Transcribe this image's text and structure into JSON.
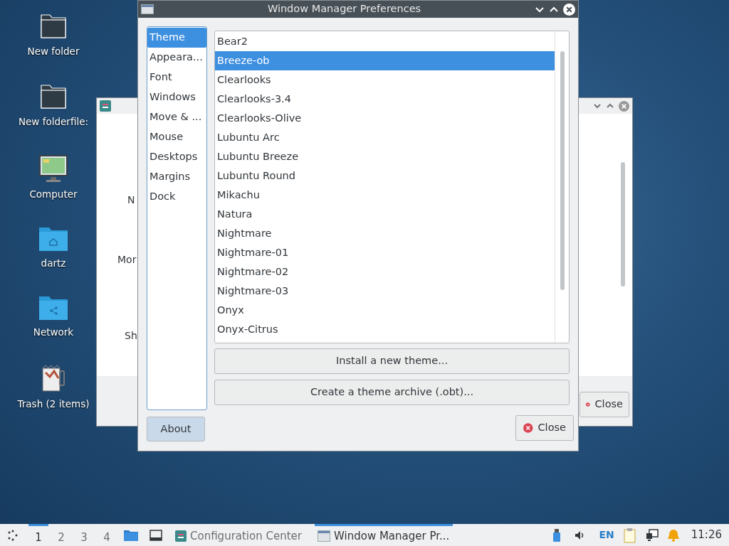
{
  "desktop_icons": [
    {
      "label": "New folder",
      "kind": "folder"
    },
    {
      "label": "New folderfile:",
      "kind": "folder"
    },
    {
      "label": "Computer",
      "kind": "computer"
    },
    {
      "label": "dartz",
      "kind": "home"
    },
    {
      "label": "Network",
      "kind": "network"
    },
    {
      "label": "Trash (2 items)",
      "kind": "trash"
    }
  ],
  "background_window": {
    "labels": [
      "N",
      "Mor",
      "Sh"
    ],
    "close_button": "Close"
  },
  "window": {
    "title": "Window Manager Preferences",
    "sidebar": [
      {
        "label": "Theme",
        "selected": true
      },
      {
        "label": "Appeara...",
        "selected": false
      },
      {
        "label": "Font",
        "selected": false
      },
      {
        "label": "Windows",
        "selected": false
      },
      {
        "label": "Move & ...",
        "selected": false
      },
      {
        "label": "Mouse",
        "selected": false
      },
      {
        "label": "Desktops",
        "selected": false
      },
      {
        "label": "Margins",
        "selected": false
      },
      {
        "label": "Dock",
        "selected": false
      }
    ],
    "themes": [
      {
        "name": "Bear2",
        "selected": false
      },
      {
        "name": "Breeze-ob",
        "selected": true
      },
      {
        "name": "Clearlooks",
        "selected": false
      },
      {
        "name": "Clearlooks-3.4",
        "selected": false
      },
      {
        "name": "Clearlooks-Olive",
        "selected": false
      },
      {
        "name": "Lubuntu Arc",
        "selected": false
      },
      {
        "name": "Lubuntu Breeze",
        "selected": false
      },
      {
        "name": "Lubuntu Round",
        "selected": false
      },
      {
        "name": "Mikachu",
        "selected": false
      },
      {
        "name": "Natura",
        "selected": false
      },
      {
        "name": "Nightmare",
        "selected": false
      },
      {
        "name": "Nightmare-01",
        "selected": false
      },
      {
        "name": "Nightmare-02",
        "selected": false
      },
      {
        "name": "Nightmare-03",
        "selected": false
      },
      {
        "name": "Onyx",
        "selected": false
      },
      {
        "name": "Onyx-Citrus",
        "selected": false
      }
    ],
    "install_button": "Install a new theme...",
    "archive_button": "Create a theme archive (.obt)...",
    "about_button": "About",
    "close_button": "Close"
  },
  "taskbar": {
    "workspaces": [
      {
        "label": "1",
        "selected": true
      },
      {
        "label": "2",
        "selected": false
      },
      {
        "label": "3",
        "selected": false
      },
      {
        "label": "4",
        "selected": false
      }
    ],
    "tasks": [
      {
        "label": "Configuration Center",
        "selected": false,
        "kind": "config"
      },
      {
        "label": "Window Manager Pr...",
        "selected": true,
        "kind": "window"
      }
    ],
    "keyboard_layout": "EN",
    "clock": "11:26"
  }
}
